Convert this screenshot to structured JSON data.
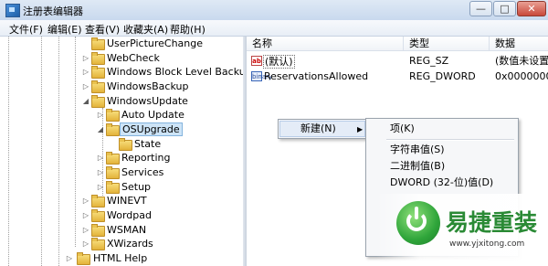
{
  "window": {
    "title": "注册表编辑器",
    "min_label": "—",
    "max_label": "□",
    "close_label": "✕"
  },
  "menubar": {
    "items": [
      "文件(F)",
      "编辑(E)",
      "查看(V)",
      "收藏夹(A)",
      "帮助(H)"
    ]
  },
  "tree": {
    "items": [
      {
        "label": "UserPictureChange"
      },
      {
        "label": "WebCheck"
      },
      {
        "label": "Windows Block Level Backup"
      },
      {
        "label": "WindowsBackup"
      },
      {
        "label": "WindowsUpdate"
      },
      {
        "label": "Auto Update"
      },
      {
        "label": "OSUpgrade"
      },
      {
        "label": "State"
      },
      {
        "label": "Reporting"
      },
      {
        "label": "Services"
      },
      {
        "label": "Setup"
      },
      {
        "label": "WINEVT"
      },
      {
        "label": "Wordpad"
      },
      {
        "label": "WSMAN"
      },
      {
        "label": "XWizards"
      },
      {
        "label": "HTML Help"
      }
    ],
    "expander_collapsed": "▷",
    "expander_expanded": "◢"
  },
  "values_pane": {
    "columns": [
      "名称",
      "类型",
      "数据"
    ],
    "rows": [
      {
        "name": "(默认)",
        "type": "REG_SZ",
        "data": "(数值未设置",
        "icon": "ab"
      },
      {
        "name": "ReservationsAllowed",
        "type": "REG_DWORD",
        "data": "0x0000000",
        "icon": "binary"
      }
    ]
  },
  "context_menu": {
    "new_label": "新建(N)",
    "submenu_arrow": "▶"
  },
  "submenu": {
    "items": [
      "项(K)",
      "字符串值(S)",
      "二进制值(B)",
      "DWORD (32-位)值(D)"
    ]
  },
  "watermark": {
    "title": "易捷重装",
    "url": "www.yjxitong.com"
  },
  "colors": {
    "accent": "#2a8a35",
    "selection": "#cde4f7"
  }
}
